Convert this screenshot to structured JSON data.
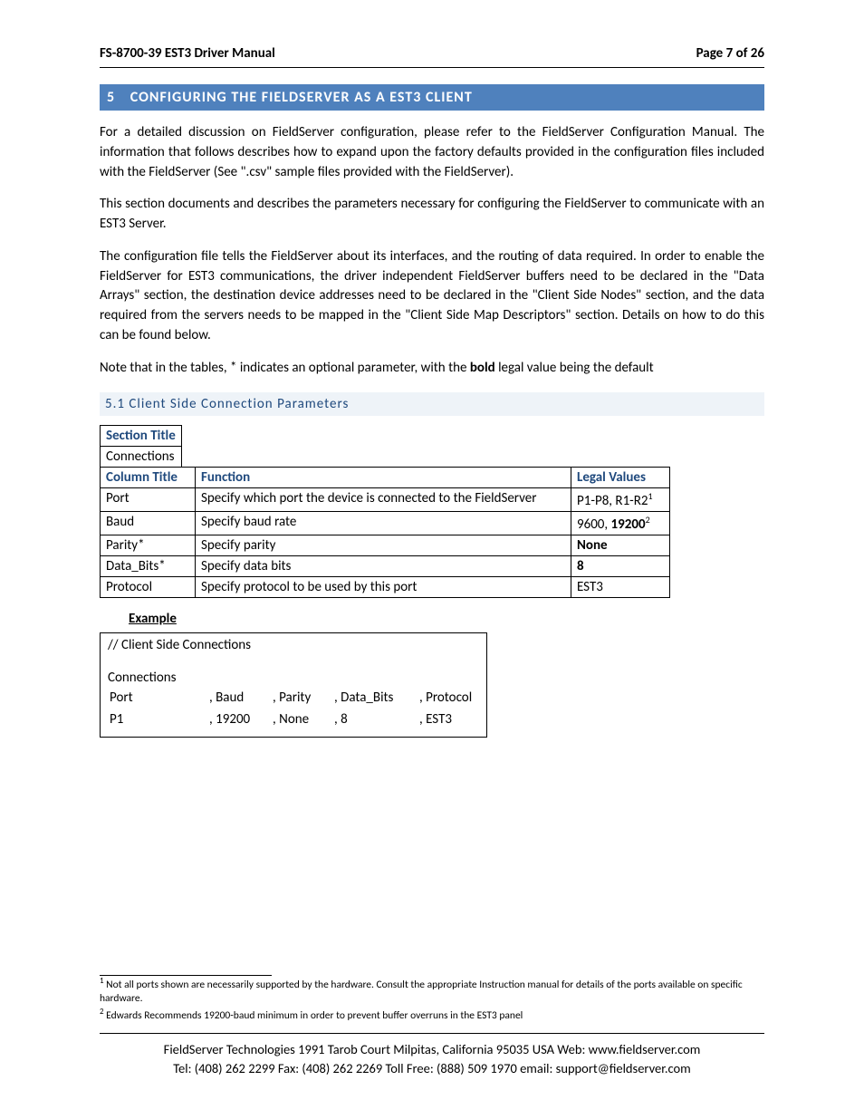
{
  "header": {
    "left": "FS-8700-39 EST3 Driver Manual",
    "right": "Page 7 of 26"
  },
  "section": {
    "number": "5",
    "title": "CONFIGURING THE FIELDSERVER AS A EST3 CLIENT"
  },
  "paragraphs": {
    "p1": "For a detailed discussion on FieldServer configuration, please refer to the FieldServer Configuration Manual.  The information that follows describes how to expand upon the factory defaults provided in the configuration files included with the FieldServer (See \".csv\" sample files provided with the FieldServer).",
    "p2": "This section documents and describes the parameters necessary for configuring the FieldServer to communicate with an EST3 Server.",
    "p3": "The configuration file tells the FieldServer about its interfaces, and the routing of data required. In order to enable the FieldServer for EST3 communications, the driver independent FieldServer buffers need to be declared in the \"Data Arrays\" section, the destination device addresses need to be declared in the \"Client Side Nodes\" section, and the data required from the servers needs to be mapped in the \"Client Side Map Descriptors\" section.  Details on how to do this can be found below.",
    "p4_pre": "Note that in the tables, * indicates an optional parameter, with the ",
    "p4_bold": "bold",
    "p4_post": " legal value being the default"
  },
  "subsection": "5.1 Client Side Connection Parameters",
  "table": {
    "section_title_h": "Section Title",
    "section_title_v": "Connections",
    "col_h1": "Column Title",
    "col_h2": "Function",
    "col_h3": "Legal Values",
    "rows": [
      {
        "c1": "Port",
        "c2": "Specify which port the device is connected to the FieldServer",
        "c3_pre": "P1-P8, R1-R2",
        "c3_sup": "1"
      },
      {
        "c1": "Baud",
        "c2": "Specify baud rate",
        "c3_pre": "9600, ",
        "c3_bold": "19200",
        "c3_sup": "2"
      },
      {
        "c1": "Parity*",
        "c2": "Specify parity",
        "c3_bold": "None"
      },
      {
        "c1": "Data_Bits*",
        "c2": "Specify data bits",
        "c3_bold": "8"
      },
      {
        "c1": "Protocol",
        "c2": "Specify protocol to be used by this port",
        "c3_pre": "EST3"
      }
    ]
  },
  "example": {
    "label": "Example",
    "line1": "//    Client Side Connections",
    "line2": "Connections",
    "h1": "Port",
    "h2": ", Baud",
    "h3": ", Parity",
    "h4": ", Data_Bits",
    "h5": ", Protocol",
    "v1": "P1",
    "v2": ", 19200",
    "v3": ", None",
    "v4": ", 8",
    "v5": ", EST3"
  },
  "footnotes": {
    "f1_sup": "1",
    "f1": " Not all ports shown are necessarily supported by the hardware. Consult the appropriate Instruction manual for details of the ports available on specific hardware.",
    "f2_sup": "2",
    "f2": " Edwards Recommends 19200-baud minimum in order to prevent buffer overruns in the EST3 panel"
  },
  "footer": {
    "line1": "FieldServer Technologies 1991 Tarob Court Milpitas, California 95035 USA   Web: www.fieldserver.com",
    "line2": "Tel: (408) 262 2299   Fax: (408) 262 2269   Toll Free: (888) 509 1970   email: support@fieldserver.com"
  }
}
